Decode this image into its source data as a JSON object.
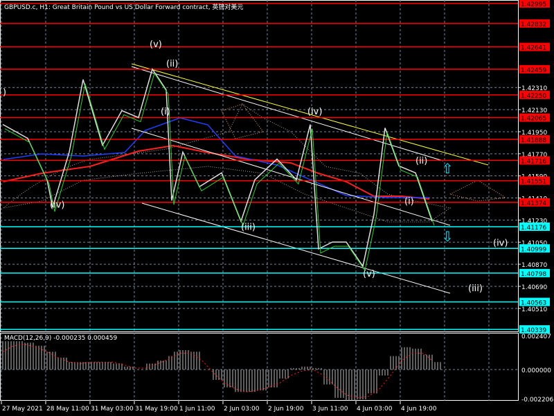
{
  "header": {
    "title": "GBPUSD.c, H1:  Great Britain Pound vs US Dollar Forward contract, 英镑对美元"
  },
  "macd": {
    "label": "MACD(12,26,9) -0.000235 0.000459",
    "axis": [
      "0.002407",
      "0.000000",
      "-0.002206"
    ]
  },
  "chart_data": {
    "type": "line",
    "title": "GBPUSD.c, H1",
    "ylim": [
      1.40339,
      1.42995
    ],
    "price_ticks": [
      "1.42310",
      "1.42130",
      "1.41950",
      "1.41770",
      "1.41590",
      "1.41410",
      "1.41230",
      "1.41050",
      "1.40870",
      "1.40690",
      "1.40510"
    ],
    "x_ticks": [
      "27 May 2021",
      "28 May 11:00",
      "31 May 03:00",
      "31 May 19:00",
      "1 Jun 11:00",
      "2 Jun 03:00",
      "2 Jun 19:00",
      "3 Jun 11:00",
      "4 Jun 03:00",
      "4 Jun 19:00"
    ],
    "levels": [
      {
        "value": "1.42995",
        "color": "#ff0000"
      },
      {
        "value": "1.42832",
        "color": "#ff0000"
      },
      {
        "value": "1.42641",
        "color": "#ff0000"
      },
      {
        "value": "1.42459",
        "color": "#ff0000"
      },
      {
        "value": "1.42250",
        "color": "#ff0000"
      },
      {
        "value": "1.42065",
        "color": "#ff0000"
      },
      {
        "value": "1.41888",
        "color": "#ff0000"
      },
      {
        "value": "1.41716",
        "color": "#ff0000"
      },
      {
        "value": "1.41551",
        "color": "#ff0000"
      },
      {
        "value": "1.41374",
        "color": "#ff0000"
      },
      {
        "value": "1.41176",
        "color": "#00ffff"
      },
      {
        "value": "1.40999",
        "color": "#00ffff"
      },
      {
        "value": "1.40798",
        "color": "#00ffff"
      },
      {
        "value": "1.40563",
        "color": "#00ffff"
      },
      {
        "value": "1.40339",
        "color": "#00ffff"
      }
    ],
    "price_series": {
      "bar": [
        1,
        10,
        17,
        19,
        25,
        30,
        37,
        44,
        50,
        55,
        60,
        62,
        66,
        72,
        80,
        87,
        92,
        100,
        107,
        112,
        115,
        120,
        125,
        131,
        135,
        139,
        144,
        150,
        156
      ],
      "close": [
        1.42009,
        1.41896,
        1.41558,
        1.41333,
        1.41784,
        1.42375,
        1.4184,
        1.42122,
        1.42065,
        1.4246,
        1.42291,
        1.41389,
        1.41784,
        1.41502,
        1.41615,
        1.4122,
        1.41558,
        1.41727,
        1.41558,
        1.42009,
        1.40995,
        1.41051,
        1.41051,
        1.40854,
        1.41277,
        1.41981,
        1.41671,
        1.41615,
        1.4122
      ]
    },
    "wave_labels": [
      {
        "text": "(v)",
        "bar": 54,
        "price": 1.4264
      },
      {
        "text": "(ii)",
        "bar": 60,
        "price": 1.4248
      },
      {
        "text": "(i)",
        "bar": 58,
        "price": 1.4209
      },
      {
        "text": "(iv)",
        "bar": 111,
        "price": 1.4209
      },
      {
        "text": "(iv)",
        "bar": 18,
        "price": 1.4133
      },
      {
        "text": "(iii)",
        "bar": 87,
        "price": 1.4115
      },
      {
        "text": "(v)",
        "bar": 131,
        "price": 1.4077
      },
      {
        "text": "(ii)",
        "bar": 150,
        "price": 1.4169
      },
      {
        "text": "(i)",
        "bar": 146,
        "price": 1.4136
      },
      {
        "text": "(iv)",
        "bar": 178,
        "price": 1.4102
      },
      {
        "text": "(iii)",
        "bar": 169,
        "price": 1.4065
      },
      {
        "text": ")",
        "bar": 1,
        "price": 1.4225
      }
    ],
    "macd_series": {
      "bar": [
        1,
        5,
        9,
        13,
        17,
        21,
        25,
        29,
        33,
        37,
        41,
        45,
        49,
        53,
        57,
        61,
        63,
        65,
        69,
        73,
        77,
        81,
        85,
        89,
        93,
        97,
        101,
        105,
        109,
        113,
        117,
        121,
        125,
        129,
        133,
        137,
        141,
        145,
        149,
        153,
        156
      ],
      "hist": [
        0.0019,
        0.0019,
        0.0018,
        0.0016,
        0.0012,
        0.0008,
        0.0005,
        0.0005,
        0.0005,
        0.0005,
        0.0004,
        0.0002,
        0.0,
        0.0004,
        0.0006,
        0.0009,
        0.0012,
        0.0013,
        0.0012,
        0.0,
        -0.0007,
        -0.0012,
        -0.0015,
        -0.0015,
        -0.0014,
        -0.0012,
        -0.0006,
        0.0001,
        0.0002,
        0.0001,
        -0.001,
        -0.0019,
        -0.0021,
        -0.002,
        -0.0016,
        -0.0004,
        0.0009,
        0.0015,
        0.0014,
        0.001,
        0.0005
      ],
      "signal": [
        0.0012,
        0.0016,
        0.0017,
        0.0015,
        0.0012,
        0.0008,
        0.0005,
        0.0004,
        0.0005,
        0.0005,
        0.0005,
        0.0003,
        0.0001,
        0.0001,
        0.0004,
        0.0007,
        0.0009,
        0.0011,
        0.0011,
        0.0006,
        -0.0002,
        -0.0009,
        -0.0013,
        -0.0015,
        -0.0014,
        -0.0012,
        -0.0009,
        -0.0004,
        -0.0001,
        0.0,
        -0.0004,
        -0.0011,
        -0.0017,
        -0.0019,
        -0.0018,
        -0.0013,
        -0.0004,
        0.0006,
        0.0011,
        0.0011,
        0.0006
      ]
    }
  }
}
